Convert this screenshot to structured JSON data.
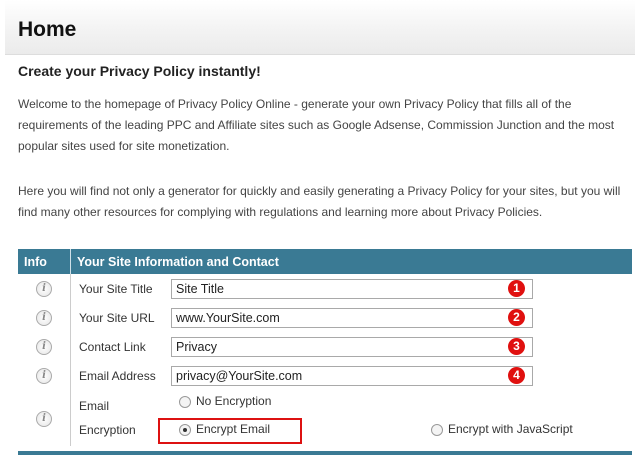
{
  "header": {
    "title": "Home"
  },
  "subtitle": "Create your Privacy Policy instantly!",
  "paragraphs": [
    "Welcome to the homepage of Privacy Policy Online - generate your own Privacy Policy that fills all of the requirements of the leading PPC and Affiliate sites such as Google Adsense, Commission Junction and the most popular sites used for site monetization.",
    "Here you will find not only a generator for quickly and easily generating a Privacy Policy for your sites, but you will find many other resources for complying with regulations and learning more about Privacy Policies."
  ],
  "table": {
    "col_info": "Info",
    "col_main": "Your Site Information and Contact",
    "rows": [
      {
        "label": "Your Site Title",
        "value": "Site Title",
        "badge": "1"
      },
      {
        "label": "Your Site URL",
        "value": "www.YourSite.com",
        "badge": "2"
      },
      {
        "label": "Contact Link",
        "value": "Privacy",
        "badge": "3"
      },
      {
        "label": "Email Address",
        "value": "privacy@YourSite.com",
        "badge": "4"
      }
    ],
    "encryption": {
      "label_line1": "Email",
      "label_line2": "Encryption",
      "options": [
        "No Encryption",
        "Encrypt Email",
        "Encrypt with JavaScript"
      ],
      "selected": "Encrypt Email"
    }
  },
  "colors": {
    "header_bg": "#3a7a94",
    "badge": "#e0100f",
    "highlight_box": "#dd1111"
  },
  "icons": {
    "info": "info-circle-icon"
  }
}
